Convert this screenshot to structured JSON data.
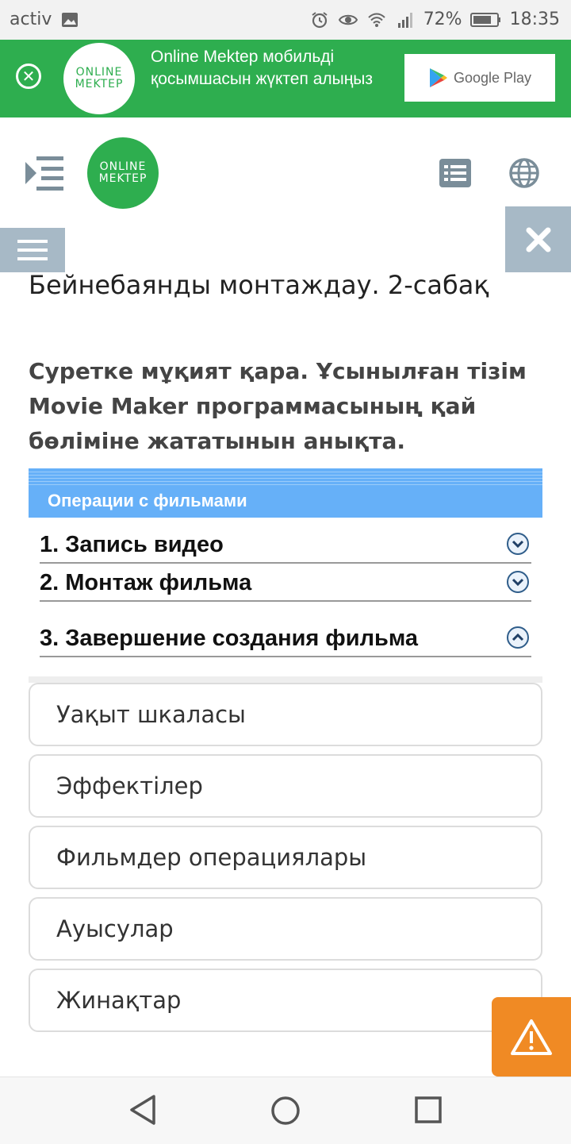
{
  "status_bar": {
    "carrier": "activ",
    "battery": "72%",
    "time": "18:35",
    "icons": [
      "image-icon",
      "alarm-icon",
      "eye-icon",
      "wifi-icon",
      "signal-icon",
      "battery-icon"
    ]
  },
  "promo": {
    "logo_line1": "ONLINE",
    "logo_line2": "MEKTEP",
    "text": "Online Mektep мобильді қосымшасын жүктеп алыңыз",
    "store_label": "Google Play",
    "color": "#2eae4f"
  },
  "header": {
    "logo_line1": "ONLINE",
    "logo_line2": "MEKTEP"
  },
  "lesson": {
    "title": "Бейнебаянды монтаждау. 2-сабақ"
  },
  "question": {
    "text": "Суретке мұқият қара. Ұсынылған тізім Movie Maker программасының қай бөліміне жататынын анықта."
  },
  "picture": {
    "header": "Операции с фильмами",
    "rows": [
      {
        "label": "1. Запись видео",
        "icon": "chevron-down-icon"
      },
      {
        "label": "2. Монтаж фильма",
        "icon": "chevron-down-icon"
      },
      {
        "label": "3. Завершение создания фильма",
        "icon": "chevron-up-icon"
      }
    ]
  },
  "options": [
    "Уақыт шкаласы",
    "Эффектілер",
    "Фильмдер операциялары",
    "Ауысулар",
    "Жинақтар"
  ],
  "colors": {
    "accent_green": "#2eae4f",
    "panel_gray": "#a7b9c6",
    "warning_orange": "#f08a24",
    "picture_header_blue": "#66b0f8"
  }
}
